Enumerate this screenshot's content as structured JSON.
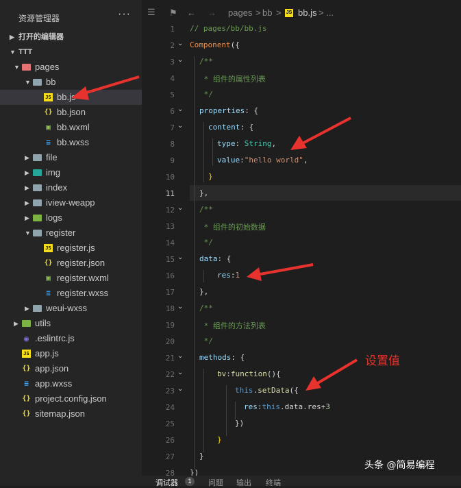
{
  "explorer": {
    "title": "资源管理器",
    "more": "···",
    "open_editors": "打开的编辑器",
    "project": "TTT",
    "tree": [
      {
        "label": "pages",
        "icon": "folder-icon"
      },
      {
        "label": "bb",
        "icon": "folder-icon"
      },
      {
        "label": "bb.js",
        "icon": "js-file-icon"
      },
      {
        "label": "bb.json",
        "icon": "json-file-icon"
      },
      {
        "label": "bb.wxml",
        "icon": "wxml-file-icon"
      },
      {
        "label": "bb.wxss",
        "icon": "wxss-file-icon"
      },
      {
        "label": "file",
        "icon": "folder-icon"
      },
      {
        "label": "img",
        "icon": "folder-icon"
      },
      {
        "label": "index",
        "icon": "folder-icon"
      },
      {
        "label": "iview-weapp",
        "icon": "folder-icon"
      },
      {
        "label": "logs",
        "icon": "folder-icon"
      },
      {
        "label": "register",
        "icon": "folder-icon"
      },
      {
        "label": "register.js",
        "icon": "js-file-icon"
      },
      {
        "label": "register.json",
        "icon": "json-file-icon"
      },
      {
        "label": "register.wxml",
        "icon": "wxml-file-icon"
      },
      {
        "label": "register.wxss",
        "icon": "wxss-file-icon"
      },
      {
        "label": "weui-wxss",
        "icon": "folder-icon"
      },
      {
        "label": "utils",
        "icon": "folder-icon"
      },
      {
        "label": ".eslintrc.js",
        "icon": "eslint-file-icon"
      },
      {
        "label": "app.js",
        "icon": "js-file-icon"
      },
      {
        "label": "app.json",
        "icon": "json-file-icon"
      },
      {
        "label": "app.wxss",
        "icon": "wxss-file-icon"
      },
      {
        "label": "project.config.json",
        "icon": "json-file-icon"
      },
      {
        "label": "sitemap.json",
        "icon": "json-file-icon"
      }
    ]
  },
  "breadcrumb": {
    "seg1": "pages",
    "sep": ">",
    "seg2": "bb",
    "seg3": "bb.js",
    "tail": "> ..."
  },
  "code": {
    "line_numbers": [
      "1",
      "2",
      "3",
      "4",
      "5",
      "6",
      "7",
      "8",
      "9",
      "10",
      "11",
      "12",
      "13",
      "14",
      "15",
      "16",
      "17",
      "18",
      "19",
      "20",
      "21",
      "22",
      "23",
      "24",
      "25",
      "26",
      "27",
      "28"
    ],
    "current_line": "11",
    "l1": "// pages/bb/bb.js",
    "l2a": "Component",
    "l2b": "({",
    "l3": "/**",
    "l4": " * 组件的属性列表",
    "l5": " */",
    "l6a": "properties",
    "l6b": ": {",
    "l7a": "content",
    "l7b": ": {",
    "l8a": "type",
    "l8b": ": ",
    "l8c": "String",
    "l8d": ",",
    "l9a": "value",
    "l9b": ":",
    "l9c": "\"hello world\"",
    "l9d": ",",
    "l10": "}",
    "l11": "},",
    "l12": "/**",
    "l13": " * 组件的初始数据",
    "l14": " */",
    "l15a": "data",
    "l15b": ": {",
    "l16a": "res",
    "l16b": ":",
    "l16c": "1",
    "l17": "},",
    "l18": "/**",
    "l19": " * 组件的方法列表",
    "l20": " */",
    "l21a": "methods",
    "l21b": ": {",
    "l22a": "bv",
    "l22b": ":",
    "l22c": "function",
    "l22d": "(){",
    "l23a": "this",
    "l23b": ".",
    "l23c": "setData",
    "l23d": "({",
    "l24a": "res",
    "l24b": ":",
    "l24c": "this",
    "l24d": ".data.res+",
    "l24e": "3",
    "l25": "})",
    "l26": "}",
    "l27": "}",
    "l28": "})"
  },
  "annotation": "设置值",
  "panel": {
    "tab1": "调试器",
    "badge": "1",
    "tab2": "问题",
    "tab3": "输出",
    "tab4": "终端"
  },
  "watermark": "头条 @简易编程",
  "colors": {
    "arrow": "#e8322d",
    "background": "#1e1e1e",
    "sidebar": "#252526"
  }
}
